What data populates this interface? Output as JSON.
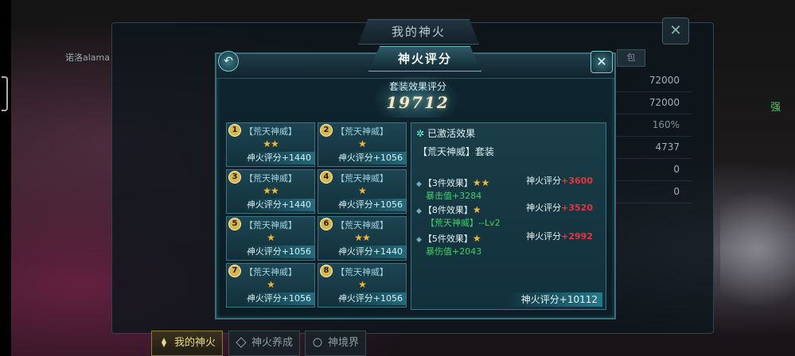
{
  "outer_window": {
    "title": "我的神火",
    "close_label": "✕",
    "bag_tab": "包",
    "user_label": "诺洛alama",
    "right_values": [
      "72000",
      "72000",
      "160%",
      "4737",
      "0",
      "0"
    ],
    "right_green": "强",
    "bottom_tabs": [
      {
        "label": "我的神火",
        "active": true
      },
      {
        "label": "神火养成",
        "active": false
      },
      {
        "label": "神境界",
        "active": false
      }
    ]
  },
  "panel": {
    "title": "神火评分",
    "back_label": "↶",
    "close_label": "✕",
    "score_label": "套装效果评分",
    "score_value": "19712"
  },
  "cards": [
    {
      "num": "1",
      "name": "【荒天神威】",
      "stars": "★★",
      "score": "神火评分+1440"
    },
    {
      "num": "2",
      "name": "【荒天神威】",
      "stars": "★",
      "score": "神火评分+1056"
    },
    {
      "num": "3",
      "name": "【荒天神威】",
      "stars": "★★",
      "score": "神火评分+1440"
    },
    {
      "num": "4",
      "name": "【荒天神威】",
      "stars": "★",
      "score": "神火评分+1056"
    },
    {
      "num": "5",
      "name": "【荒天神威】",
      "stars": "★",
      "score": "神火评分+1056"
    },
    {
      "num": "6",
      "name": "【荒天神威】",
      "stars": "★★",
      "score": "神火评分+1440"
    },
    {
      "num": "7",
      "name": "【荒天神威】",
      "stars": "★",
      "score": "神火评分+1056"
    },
    {
      "num": "8",
      "name": "【荒天神威】",
      "stars": "★",
      "score": "神火评分+1056"
    }
  ],
  "effects": {
    "header": "已激活效果",
    "set_name": "【荒天神威】套装",
    "items": [
      {
        "title": "【3件效果】",
        "stars": "★★",
        "score_label": "神火评分",
        "score_plus": "+3600",
        "sub": "暴击值+3284"
      },
      {
        "title": "【8件效果】",
        "stars": "★",
        "score_label": "神火评分",
        "score_plus": "+3520",
        "sub": "【荒天神威】--Lv2"
      },
      {
        "title": "【5件效果】",
        "stars": "★",
        "score_label": "神火评分",
        "score_plus": "+2992",
        "sub": "暴伤值+2043"
      }
    ],
    "total": "神火评分+10112"
  },
  "colors": {
    "accent": "#3d7484",
    "star": "#f0b830",
    "plus_red": "#e8333a",
    "green": "#3fd06a"
  }
}
